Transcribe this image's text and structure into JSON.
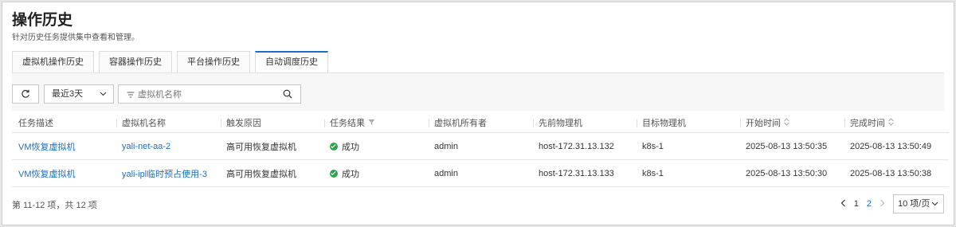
{
  "page": {
    "title": "操作历史",
    "subtitle": "针对历史任务提供集中查看和管理。"
  },
  "tabs": [
    {
      "label": "虚拟机操作历史"
    },
    {
      "label": "容器操作历史"
    },
    {
      "label": "平台操作历史"
    },
    {
      "label": "自动调度历史",
      "active": true
    }
  ],
  "toolbar": {
    "time_range": "最近3天",
    "search_placeholder": "虚拟机名称"
  },
  "table": {
    "columns": [
      "任务描述",
      "虚拟机名称",
      "触发原因",
      "任务结果",
      "虚拟机所有者",
      "先前物理机",
      "目标物理机",
      "开始时间",
      "完成时间"
    ],
    "rows": [
      {
        "desc": "VM恢复虚拟机",
        "vm_name": "yali-net-aa-2",
        "reason": "高可用恢复虚拟机",
        "result": "成功",
        "owner": "admin",
        "prev_host": "host-172.31.13.132",
        "target_host": "k8s-1",
        "start": "2025-08-13 13:50:35",
        "end": "2025-08-13 13:50:49"
      },
      {
        "desc": "VM恢复虚拟机",
        "vm_name": "yali-ipl临时预占使用-3",
        "reason": "高可用恢复虚拟机",
        "result": "成功",
        "owner": "admin",
        "prev_host": "host-172.31.13.133",
        "target_host": "k8s-1",
        "start": "2025-08-13 13:50:30",
        "end": "2025-08-13 13:50:38"
      }
    ]
  },
  "pagination": {
    "summary": "第 11-12 项，共 12 项",
    "pages": [
      "1",
      "2"
    ],
    "current": "2",
    "page_size": "10 项/页"
  },
  "colors": {
    "accent": "#1b6ec2",
    "success": "#2ea44f"
  }
}
